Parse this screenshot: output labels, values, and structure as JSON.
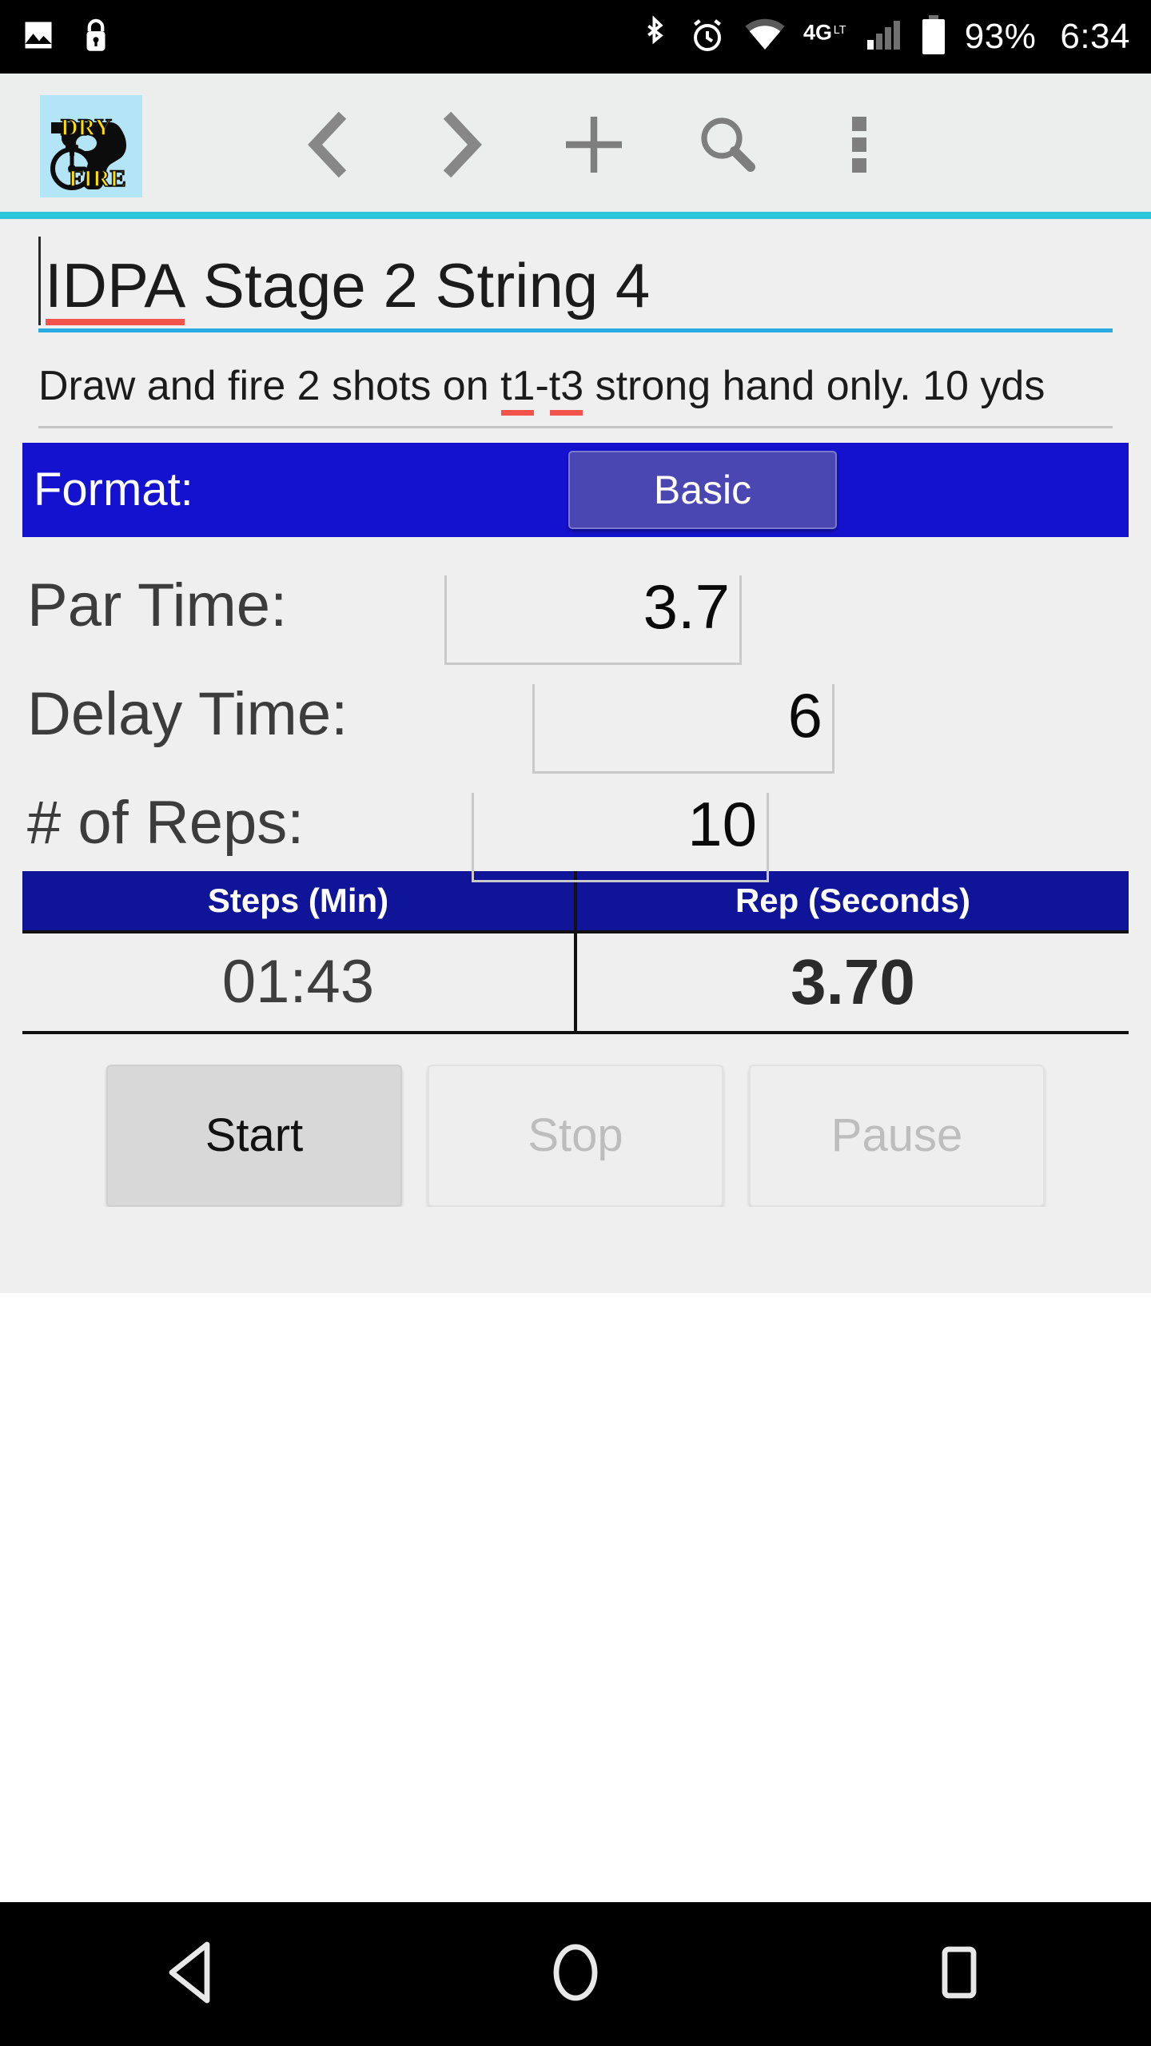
{
  "status_bar": {
    "icons_left": [
      "photo-icon",
      "lock-icon"
    ],
    "icons_right": [
      "bluetooth-icon",
      "alarm-icon",
      "wifi-icon",
      "network-4g-icon",
      "signal-bars-icon",
      "battery-icon"
    ],
    "network_label": "4G",
    "battery_percent": "93%",
    "time": "6:34"
  },
  "toolbar": {
    "app_logo": {
      "name": "dry-fire-app-logo",
      "text_top": "DRY",
      "text_bottom": "FIRE",
      "background_color": "#b3e5f7",
      "text_color": "#ffe000"
    },
    "actions": [
      {
        "name": "previous-button",
        "icon": "chevron-left-icon"
      },
      {
        "name": "next-button",
        "icon": "chevron-right-icon"
      },
      {
        "name": "add-button",
        "icon": "plus-icon"
      },
      {
        "name": "search-button",
        "icon": "search-icon"
      },
      {
        "name": "overflow-menu-button",
        "icon": "more-vertical-icon"
      }
    ],
    "accent_color": "#29c5dd"
  },
  "form": {
    "title_value": "IDPA Stage 2 String 4",
    "title_misspelled": "IDPA",
    "title_rest": " Stage 2 String 4",
    "description_line1_a": "Draw and fire 2 shots on ",
    "description_line1_t1": "t1",
    "description_line1_dash": "-",
    "description_line1_t3": "t3",
    "description_line1_b": " strong hand only.",
    "description_line2": "10 yds",
    "format_label": "Format:",
    "format_value": "Basic",
    "format_bar_color": "#1512cf",
    "fields": [
      {
        "name": "par-time",
        "label": "Par Time:",
        "value": "3.7"
      },
      {
        "name": "delay-time",
        "label": "Delay Time:",
        "value": "6"
      },
      {
        "name": "num-reps",
        "label": "# of Reps:",
        "value": "10"
      }
    ]
  },
  "timer_table": {
    "headers": [
      "Steps (Min)",
      "Rep (Seconds)"
    ],
    "values": [
      "01:43",
      "3.70"
    ],
    "header_color": "#0f1499"
  },
  "controls": [
    {
      "name": "start-button",
      "label": "Start",
      "enabled": true
    },
    {
      "name": "stop-button",
      "label": "Stop",
      "enabled": false
    },
    {
      "name": "pause-button",
      "label": "Pause",
      "enabled": false
    }
  ],
  "nav_bar": {
    "buttons": [
      {
        "name": "nav-back-button",
        "icon": "triangle-back-icon"
      },
      {
        "name": "nav-home-button",
        "icon": "circle-home-icon"
      },
      {
        "name": "nav-recents-button",
        "icon": "square-recents-icon"
      }
    ]
  }
}
